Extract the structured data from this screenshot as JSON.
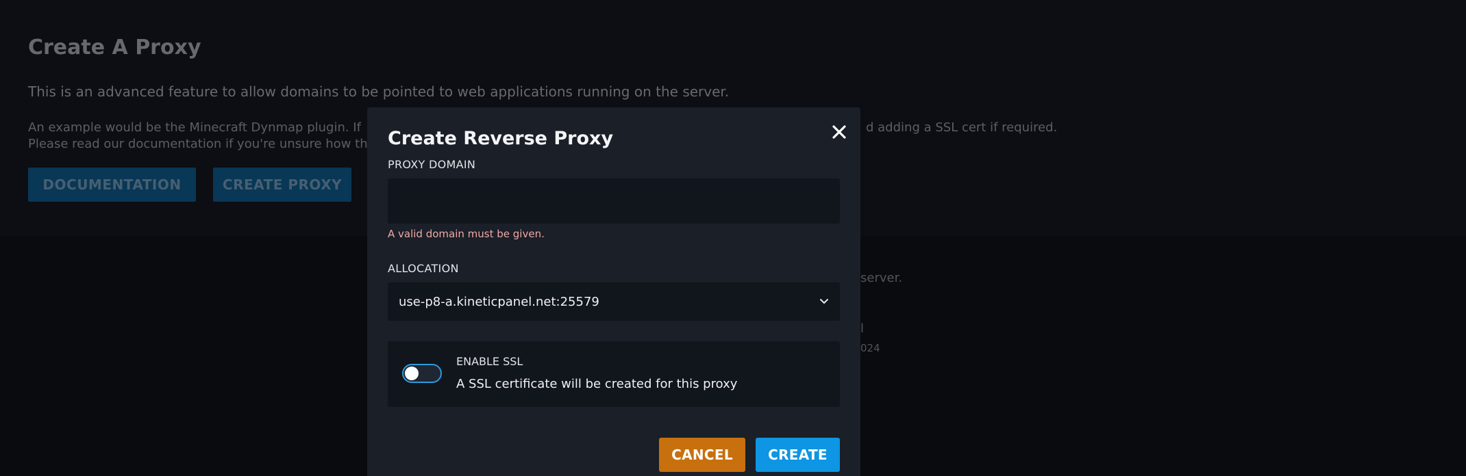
{
  "background": {
    "title": "Create A Proxy",
    "description": "This is an advanced feature to allow domains to be pointed to web applications running on the server.",
    "example_left": "An example would be the Minecraft Dynmap plugin. If",
    "example_right": "d adding a SSL cert if required.",
    "docs_text": "Please read our documentation if you're unsure how th",
    "documentation_button": "DOCUMENTATION",
    "create_proxy_button": "CREATE PROXY",
    "tail_server": "server.",
    "tail_l": "l",
    "tail_year": "024"
  },
  "modal": {
    "title": "Create Reverse Proxy",
    "proxy_domain_label": "PROXY DOMAIN",
    "proxy_domain_value": "",
    "proxy_domain_error": "A valid domain must be given.",
    "allocation_label": "ALLOCATION",
    "allocation_value": "use-p8-a.kineticpanel.net:25579",
    "ssl_label": "ENABLE SSL",
    "ssl_description": "A SSL certificate will be created for this proxy",
    "ssl_enabled": false,
    "cancel_label": "CANCEL",
    "create_label": "CREATE"
  },
  "colors": {
    "cancel": "#c7700d",
    "create": "#0e95e3",
    "toggle_border": "#2e9bde",
    "error": "#f0a8a8"
  },
  "icons": {
    "close": "close-icon",
    "chevron": "chevron-down-icon"
  }
}
